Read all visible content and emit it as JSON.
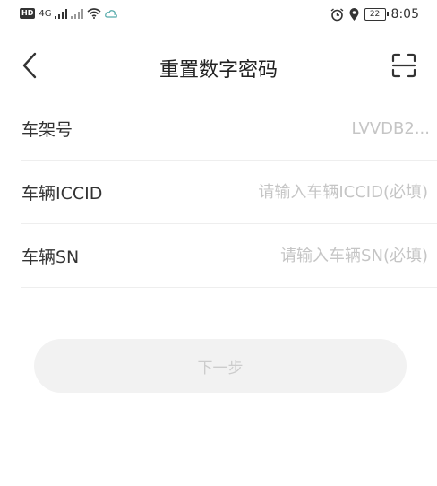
{
  "status_bar": {
    "hd": "HD",
    "network": "4G",
    "time": "8:05",
    "battery": "22"
  },
  "header": {
    "title": "重置数字密码"
  },
  "form": {
    "vin_label": "车架号",
    "vin_value": "LVVDB2...",
    "iccid_label": "车辆ICCID",
    "iccid_placeholder": "请输入车辆ICCID(必填)",
    "sn_label": "车辆SN",
    "sn_placeholder": "请输入车辆SN(必填)"
  },
  "actions": {
    "next_label": "下一步"
  },
  "icons": {
    "back": "chevron-left-icon",
    "scan": "scan-icon"
  },
  "colors": {
    "label": "#333333",
    "placeholder": "#c5c5c5",
    "button_bg": "#f2f2f2",
    "button_text": "#cccccc"
  }
}
